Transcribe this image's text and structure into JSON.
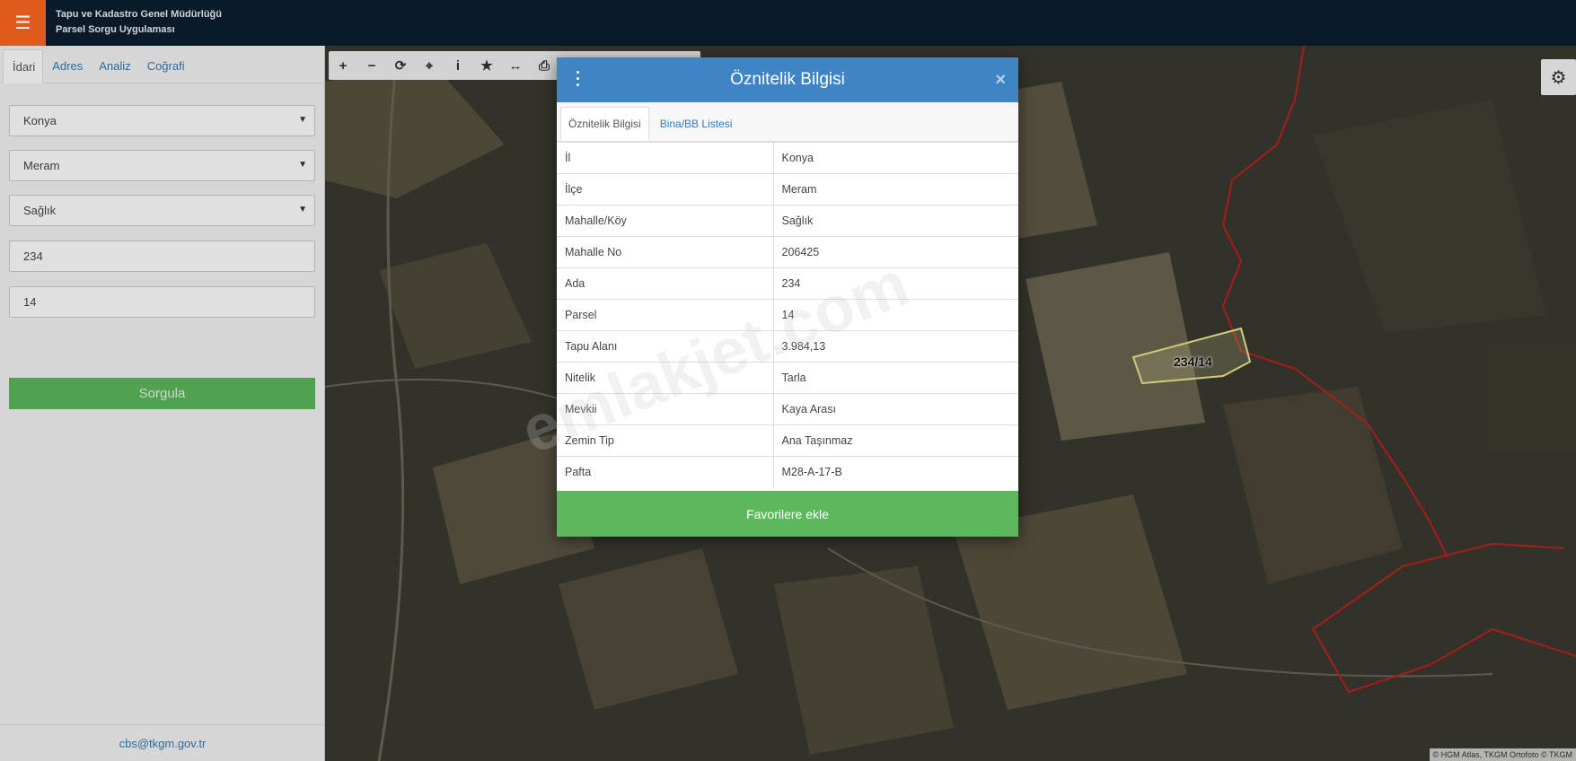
{
  "header": {
    "menu_icon": "hamburger-icon",
    "title_line1": "Tapu ve Kadastro Genel Müdürlüğü",
    "title_line2": "Parsel Sorgu Uygulaması",
    "accent": "#e05a1e"
  },
  "sidebar": {
    "tabs": [
      {
        "label": "İdari",
        "active": true
      },
      {
        "label": "Adres",
        "active": false
      },
      {
        "label": "Analiz",
        "active": false
      },
      {
        "label": "Coğrafi",
        "active": false
      }
    ],
    "province": "Konya",
    "district": "Meram",
    "neighborhood": "Sağlık",
    "block": "234",
    "parcel": "14",
    "query_button": "Sorgula",
    "footer_email": "cbs@tkgm.gov.tr"
  },
  "map": {
    "toolbar_icons": [
      "plus-icon",
      "minus-icon",
      "refresh-icon",
      "locate-icon",
      "info-icon",
      "star-icon",
      "measure-icon",
      "print-icon"
    ],
    "parcel_label": "234/14",
    "attribution": "© HGM Atlas, TKGM Ortofoto © TKGM",
    "settings_icon": "gear-icon"
  },
  "modal": {
    "title": "Öznitelik Bilgisi",
    "tabs": [
      {
        "label": "Öznitelik Bilgisi",
        "active": true
      },
      {
        "label": "Bina/BB Listesi",
        "active": false
      }
    ],
    "rows": [
      {
        "key": "İl",
        "value": "Konya"
      },
      {
        "key": "İlçe",
        "value": "Meram"
      },
      {
        "key": "Mahalle/Köy",
        "value": "Sağlık"
      },
      {
        "key": "Mahalle No",
        "value": "206425"
      },
      {
        "key": "Ada",
        "value": "234"
      },
      {
        "key": "Parsel",
        "value": "14"
      },
      {
        "key": "Tapu Alanı",
        "value": "3.984,13"
      },
      {
        "key": "Nitelik",
        "value": "Tarla"
      },
      {
        "key": "Mevkii",
        "value": "Kaya Arası"
      },
      {
        "key": "Zemin Tip",
        "value": "Ana Taşınmaz"
      },
      {
        "key": "Pafta",
        "value": "M28-A-17-B"
      }
    ],
    "favorite_button": "Favorilere ekle",
    "header_color": "#3f84c5"
  },
  "watermark": "emlakjet.com"
}
